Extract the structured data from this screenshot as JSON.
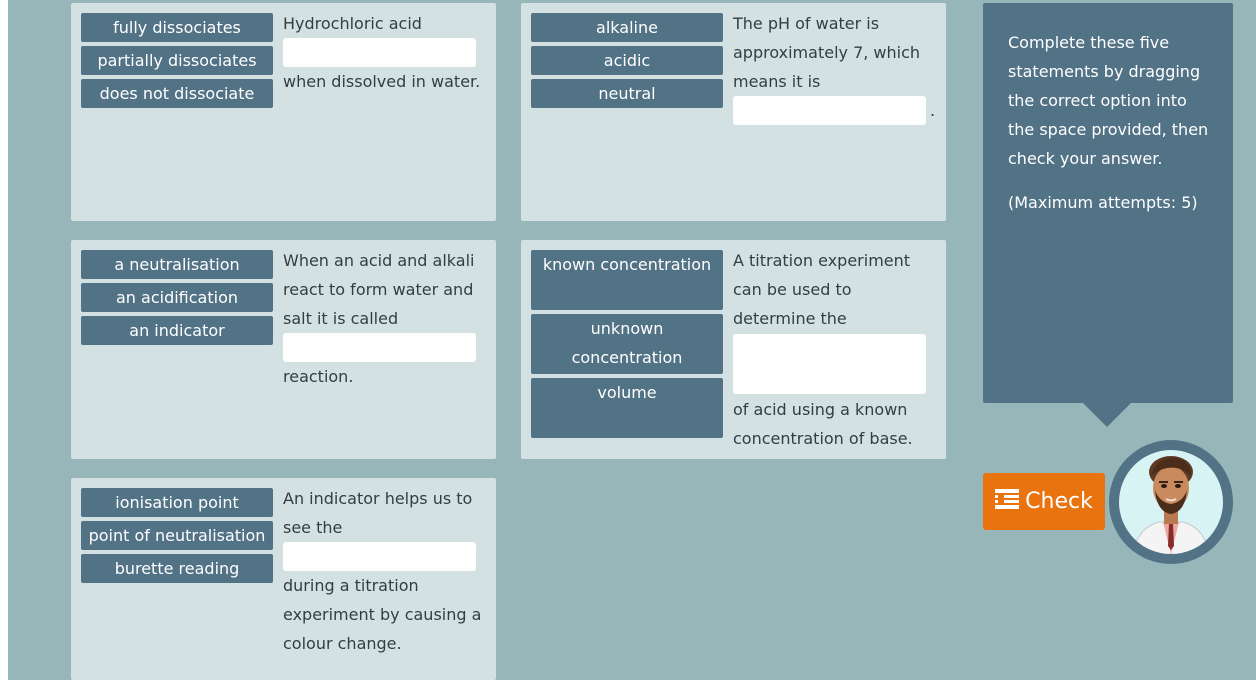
{
  "cards": [
    {
      "options": [
        "fully dissociates",
        "partially dissociates",
        "does not dissociate"
      ],
      "text_before": "Hydrochloric acid",
      "text_after": "when dissolved in water."
    },
    {
      "options": [
        "alkaline",
        "acidic",
        "neutral"
      ],
      "text_before": "The pH of water is approximately 7, which means it is",
      "text_after": "."
    },
    {
      "options": [
        "a neutralisation",
        "an acidification",
        "an indicator"
      ],
      "text_before": "When an acid and alkali react to form water and salt it is called",
      "text_after": "reaction."
    },
    {
      "options": [
        "known concentration",
        "unknown concentration",
        "volume"
      ],
      "text_before": "A titration experiment can be used to determine the",
      "text_after": "of acid using a known concentration of base."
    },
    {
      "options": [
        "ionisation point",
        "point of neutralisation",
        "burette reading"
      ],
      "text_before": "An indicator helps us to see the",
      "text_after": "during a titration experiment by causing a colour change."
    }
  ],
  "instructions": {
    "main": "Complete these five statements by dragging the correct option into the space provided, then check your answer.",
    "attempts": "(Maximum attempts: 5)"
  },
  "check_button": {
    "label": "Check",
    "icon": "check-list-icon",
    "color": "#e8730f"
  },
  "colors": {
    "background": "#97b6b9",
    "card": "#d4e1e2",
    "option": "#527286"
  }
}
